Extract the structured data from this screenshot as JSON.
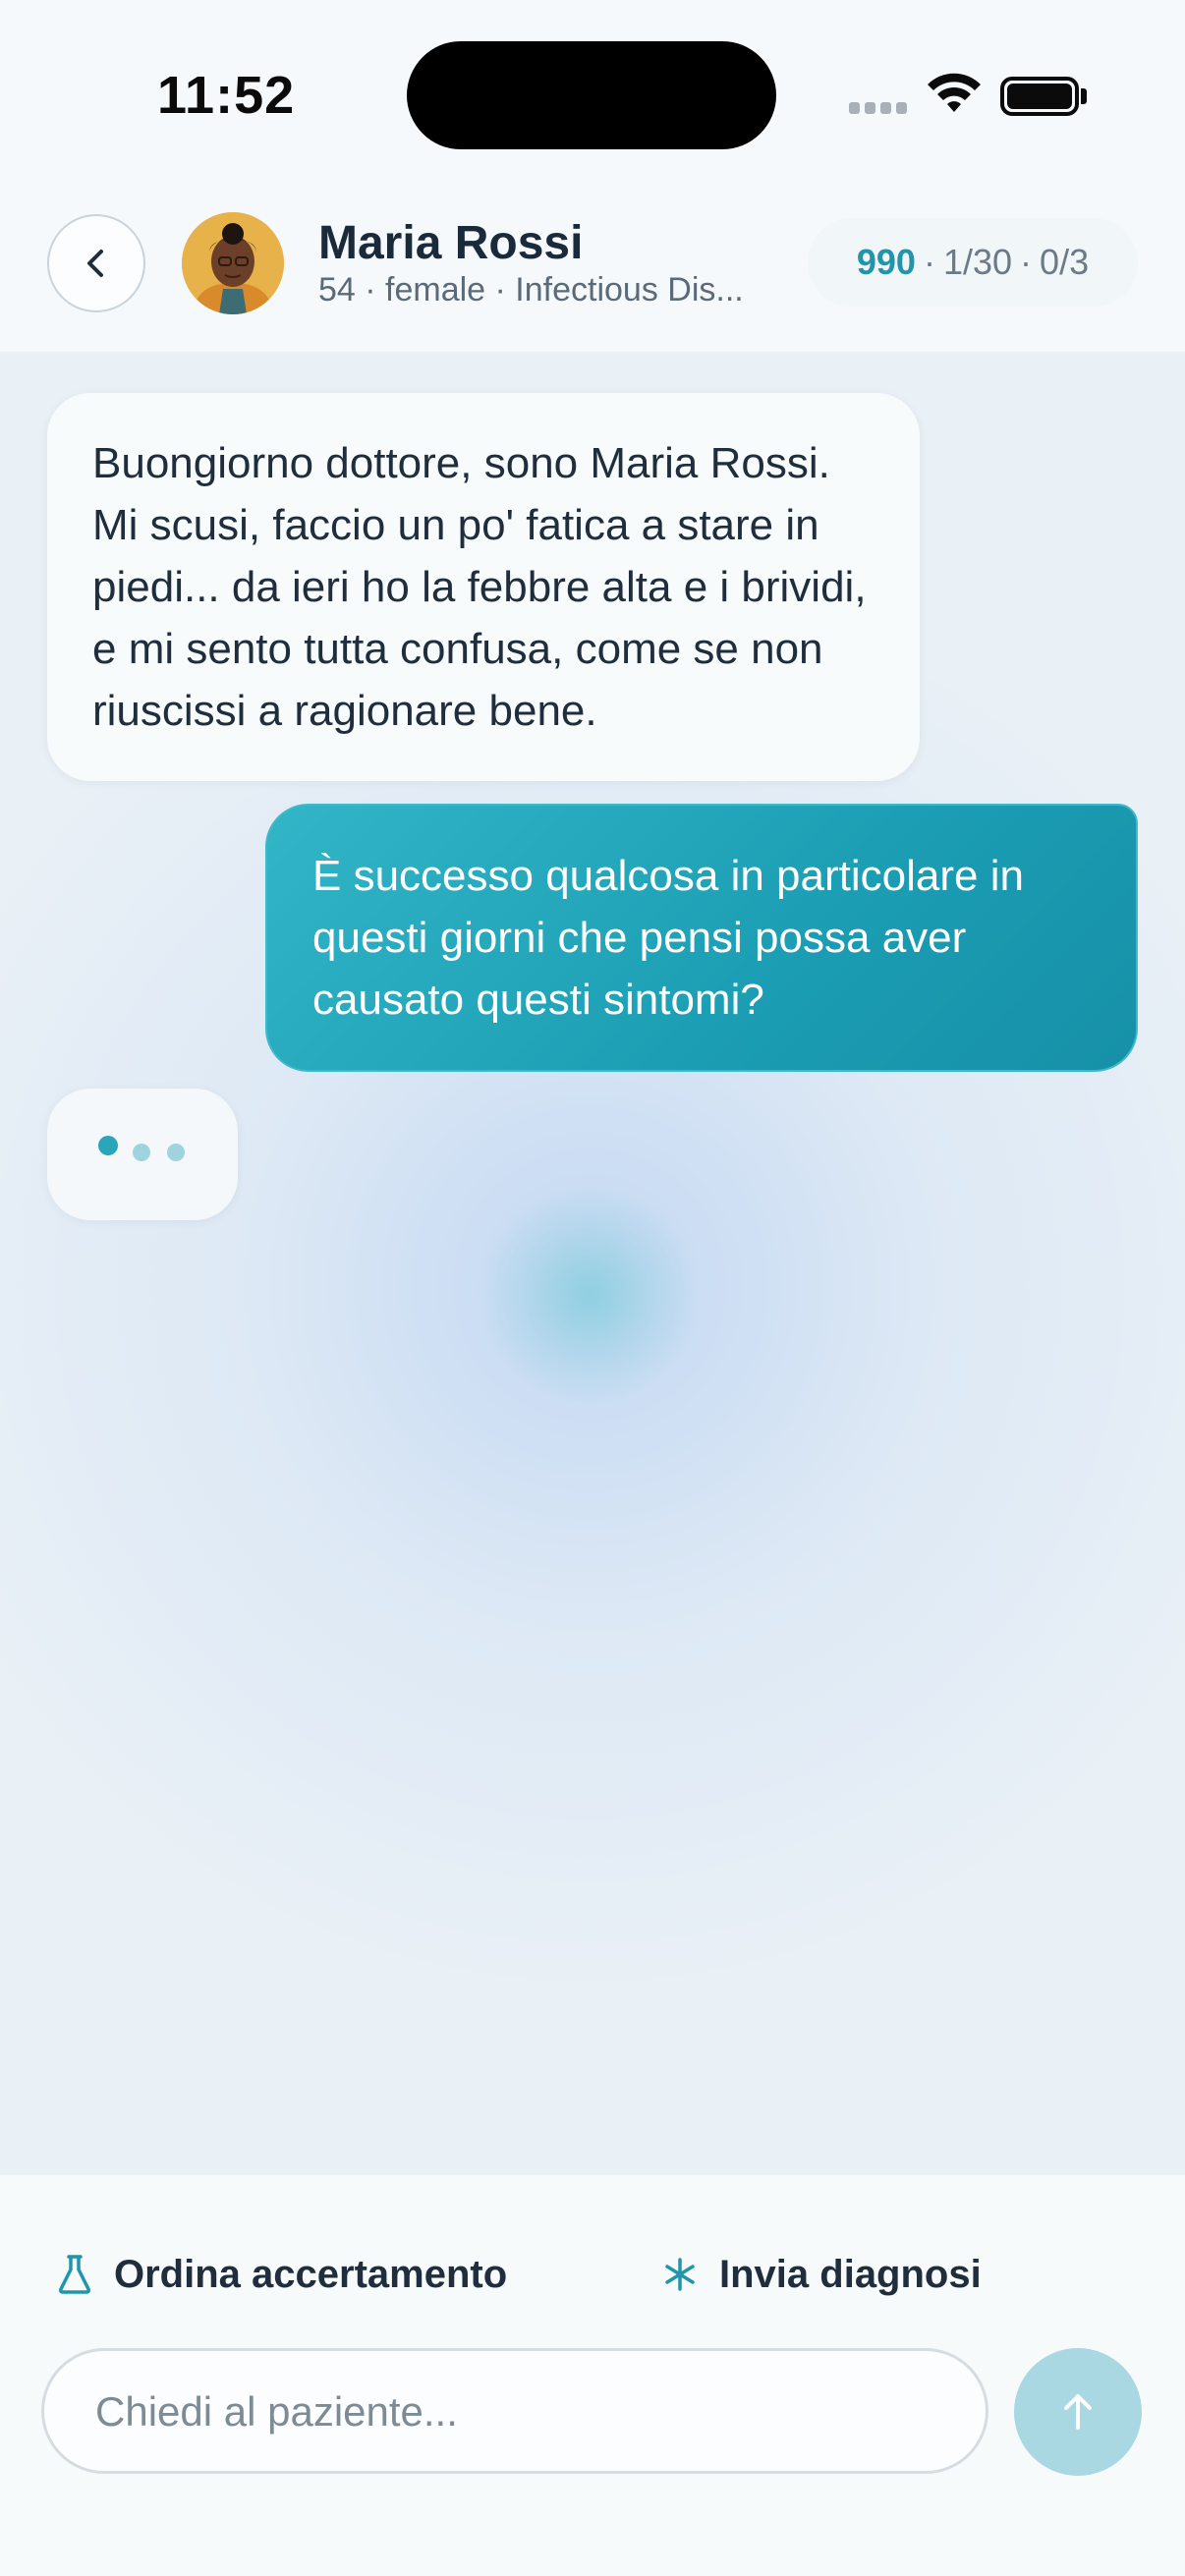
{
  "status_bar": {
    "time": "11:52"
  },
  "header": {
    "patient_name": "Maria Rossi",
    "patient_subtitle": "54 · female · Infectious Dis...",
    "score": "990",
    "questions": "1/30",
    "diagnoses": "0/3",
    "separator": "·"
  },
  "chat": {
    "messages": [
      {
        "sender": "patient",
        "text": "Buongiorno dottore, sono Maria Rossi. Mi scusi, faccio un po' fatica a stare in piedi... da ieri ho la febbre alta e i brividi, e mi sento tutta confusa, come se non riuscissi a ragionare bene."
      },
      {
        "sender": "doctor",
        "text": "È successo qualcosa in particolare in questi giorni che pensi possa aver causato questi sintomi?"
      }
    ]
  },
  "actions": {
    "order_test_label": "Ordina accertamento",
    "send_diagnosis_label": "Invia diagnosi"
  },
  "input": {
    "placeholder": "Chiedi al paziente...",
    "value": ""
  },
  "colors": {
    "accent": "#1f96aa",
    "send_button": "#a9d7e2",
    "doctor_bubble": "#1b9db3"
  },
  "icons": [
    "chevron-left-icon",
    "flask-icon",
    "asterisk-icon",
    "arrow-up-icon",
    "wifi-icon",
    "battery-icon",
    "signal-icon"
  ]
}
